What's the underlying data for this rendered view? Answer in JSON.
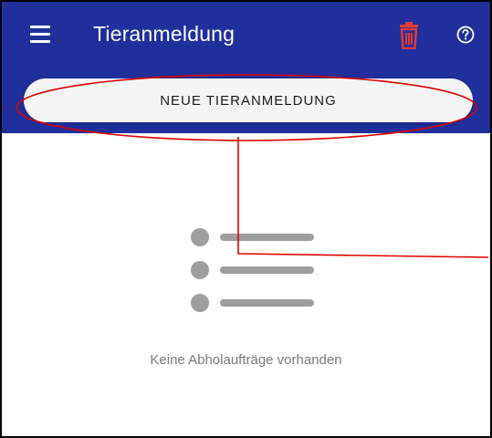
{
  "appbar": {
    "title": "Tieranmeldung",
    "background_color": "#1f2f9c",
    "menu_icon": "hamburger-menu-icon",
    "delete_icon": "trash-icon",
    "delete_icon_color": "#e53935",
    "help_icon": "help-circle-icon"
  },
  "actions": {
    "new_label": "NEUE TIERANMELDUNG"
  },
  "empty_state": {
    "icon": "list-placeholder-icon",
    "message": "Keine Abholaufträge vorhanden"
  },
  "annotation": {
    "color": "#e00000"
  }
}
